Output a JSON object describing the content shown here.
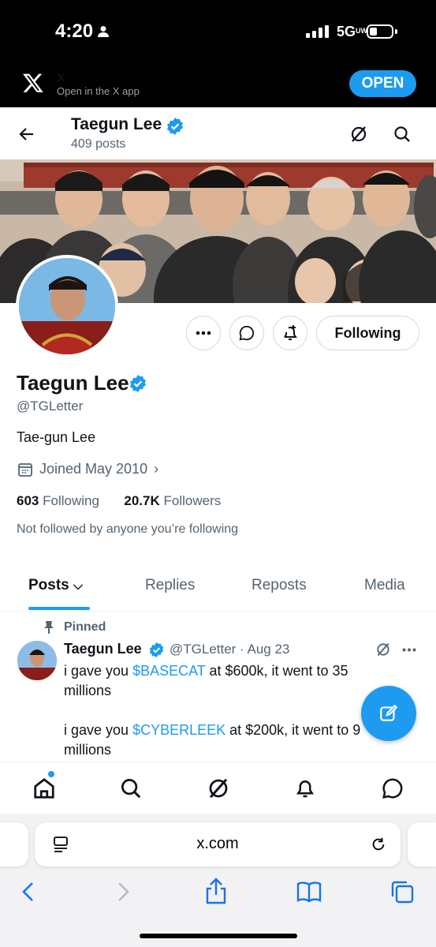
{
  "status_bar": {
    "time": "4:20",
    "network": "5G",
    "network_sub": "UW"
  },
  "app_banner": {
    "app_name": "X",
    "subtitle": "Open in the X app",
    "open_label": "OPEN"
  },
  "header": {
    "name": "Taegun Lee",
    "posts": "409 posts"
  },
  "profile": {
    "name": "Taegun Lee",
    "handle": "@TGLetter",
    "bio": "Tae-gun Lee",
    "joined": "Joined May 2010",
    "following_count": "603",
    "following_label": "Following",
    "followers_count": "20.7K",
    "followers_label": "Followers",
    "followed_note": "Not followed by anyone you’re following",
    "follow_button_label": "Following"
  },
  "tabs": [
    {
      "label": "Posts"
    },
    {
      "label": "Replies"
    },
    {
      "label": "Reposts"
    },
    {
      "label": "Media"
    }
  ],
  "pinned_tweet": {
    "pinned_label": "Pinned",
    "name": "Taegun Lee",
    "meta": "@TGLetter · Aug 23",
    "line1_pre": "i gave you ",
    "line1_cash": "$BASECAT",
    "line1_post": " at $600k, it went to 35 millions",
    "line2_pre": "i gave you ",
    "line2_cash": "$CYBERLEEK",
    "line2_post": " at $200k, it went to 9 millions"
  },
  "browser": {
    "url": "x.com"
  },
  "colors": {
    "accent": "#1d9bf0",
    "text": "#0f1419",
    "secondary": "#536471"
  }
}
